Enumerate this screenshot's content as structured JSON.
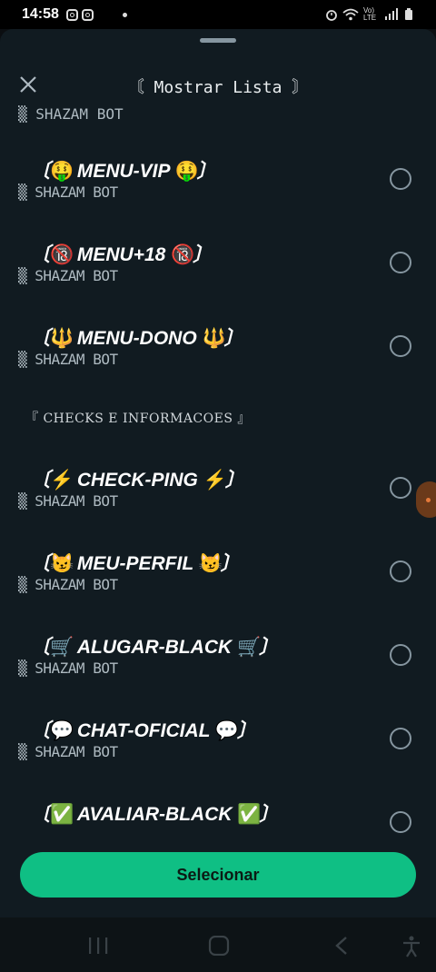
{
  "status": {
    "time": "14:58",
    "network": "Vo) LTE"
  },
  "sheet": {
    "title": "〘 Mostrar Lista 〙",
    "top_cut_subtitle": "▒ SHAZAM BOT",
    "section_heading": "『 CHECKS E INFORMACOES 』",
    "items": [
      {
        "prefix": "〔",
        "emoji_left": "🤑",
        "label": "MENU-VIP",
        "emoji_right": "🤑",
        "suffix": "〕",
        "subtitle": "▒ SHAZAM BOT"
      },
      {
        "prefix": "〔",
        "emoji_left": "🔞",
        "label": "MENU+18",
        "emoji_right": "🔞",
        "suffix": "〕",
        "subtitle": "▒ SHAZAM BOT"
      },
      {
        "prefix": "〔",
        "emoji_left": "🔱",
        "label": "MENU-DONO",
        "emoji_right": "🔱",
        "suffix": "〕",
        "subtitle": "▒ SHAZAM BOT"
      },
      {
        "prefix": "〔",
        "emoji_left": "⚡",
        "label": "CHECK-PING",
        "emoji_right": "⚡",
        "suffix": "〕",
        "subtitle": "▒ SHAZAM BOT"
      },
      {
        "prefix": "〔",
        "emoji_left": "😼",
        "label": "MEU-PERFIL",
        "emoji_right": "😼",
        "suffix": "〕",
        "subtitle": "▒ SHAZAM BOT"
      },
      {
        "prefix": "〔",
        "emoji_left": "🛒",
        "label": "ALUGAR-BLACK",
        "emoji_right": "🛒",
        "suffix": "〕",
        "subtitle": "▒ SHAZAM BOT"
      },
      {
        "prefix": "〔",
        "emoji_left": "💬",
        "label": "CHAT-OFICIAL",
        "emoji_right": "💬",
        "suffix": "〕",
        "subtitle": "▒ SHAZAM BOT"
      },
      {
        "prefix": "〔",
        "emoji_left": "✅",
        "label": "AVALIAR-BLACK",
        "emoji_right": "✅",
        "suffix": "〕",
        "subtitle": ""
      }
    ],
    "select_label": "Selecionar"
  },
  "icons": {
    "close": "close-icon",
    "radio": "radio-unselected-icon",
    "nav_recents": "recents-icon",
    "nav_home": "home-icon",
    "nav_back": "back-icon",
    "nav_accessibility": "accessibility-icon"
  },
  "colors": {
    "background": "#111b21",
    "accent": "#0fbf84"
  }
}
